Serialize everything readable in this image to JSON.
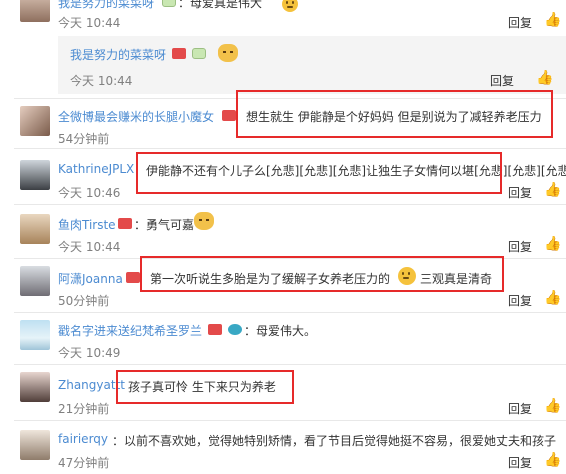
{
  "comments": [
    {
      "user": "我是努力的菜菜呀",
      "text": "：母爱真是伟大",
      "time": "今天 10:44",
      "reply": "回复"
    },
    {
      "user": "我是努力的菜菜呀",
      "text": "",
      "time": "今天 10:44",
      "reply": "回复"
    },
    {
      "user": "全微博最会赚米的长腿小魔女",
      "text": "想生就生 伊能静是个好妈妈 但是别说为了减轻养老压力",
      "time": "54分钟前",
      "reply": "回复"
    },
    {
      "user": "KathrineJPLX",
      "text": "伊能静不还有个儿子么[允悲][允悲][允悲]让独生子女情何以堪[允悲][允悲][允悲]",
      "time": "今天 10:46",
      "reply": "回复"
    },
    {
      "user": "鱼肉Tirste",
      "text": "：勇气可嘉",
      "time": "今天 10:44",
      "reply": "回复"
    },
    {
      "user": "阿潇Joanna",
      "text": "第一次听说生多胎是为了缓解子女养老压力的",
      "text2": "三观真是清奇",
      "time": "50分钟前",
      "reply": "回复"
    },
    {
      "user": "戳名字进来送纪梵希圣罗兰",
      "text": "：母爱伟大。",
      "time": "今天 10:49",
      "reply": "回复"
    },
    {
      "user": "Zhangyattt",
      "text": "孩子真可怜 生下来只为养老",
      "time": "21分钟前",
      "reply": "回复"
    },
    {
      "user": "fairierqy",
      "text": "：以前不喜欢她，觉得她特别矫情，看了节目后觉得她挺不容易，很爱她丈夫和孩子",
      "time": "47分钟前",
      "reply": "回复"
    }
  ]
}
